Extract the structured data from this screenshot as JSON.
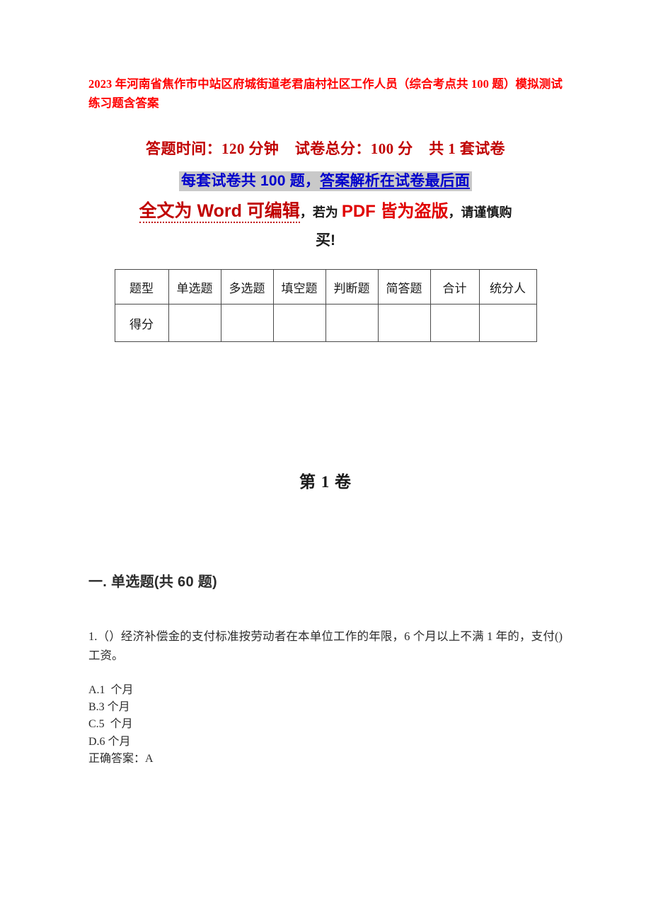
{
  "document": {
    "title": "2023 年河南省焦作市中站区府城街道老君庙村社区工作人员（综合考点共 100 题）模拟测试练习题含答案",
    "title_color": "#ff0000"
  },
  "notice": {
    "line1": "答题时间：120 分钟    试卷总分：100 分    共 1 套试卷",
    "line1_color": "#c00000",
    "line2_plain": "每套试卷共 100 题，",
    "line2_underlined": "答案解析在试卷最后面",
    "line2_color": "#0000cc",
    "line2_highlight": "#c9c9c9",
    "line3_word": "全文为 Word 可编辑",
    "line3_comma1": "，",
    "line3_ruowei": "若为 ",
    "line3_pdf": "PDF 皆为盗版",
    "line3_comma2": "，",
    "line3_tail": "请谨慎购",
    "line4": "买!",
    "word_color": "#c00000",
    "pdf_color": "#e00000"
  },
  "score_table": {
    "headers": [
      "题型",
      "单选题",
      "多选题",
      "填空题",
      "判断题",
      "简答题",
      "合计",
      "统分人"
    ],
    "row_label": "得分",
    "row_values": [
      "",
      "",
      "",
      "",
      "",
      "",
      ""
    ]
  },
  "volume": {
    "heading": "第 1 卷"
  },
  "section": {
    "heading": "一. 单选题(共 60 题)"
  },
  "question": {
    "stem": "1.（）经济补偿金的支付标准按劳动者在本单位工作的年限，6 个月以上不满 1 年的，支付()工资。",
    "options": [
      "A.1  个月",
      "B.3 个月",
      "C.5  个月",
      "D.6 个月"
    ],
    "answer_line": "正确答案：A"
  }
}
